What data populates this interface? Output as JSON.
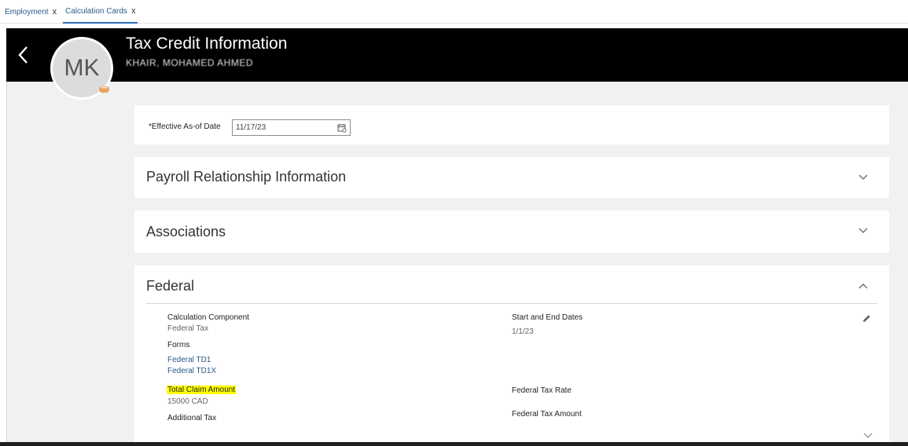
{
  "tabs": [
    {
      "label": "Employment",
      "close": "x"
    },
    {
      "label": "Calculation Cards",
      "close": "x"
    }
  ],
  "header": {
    "title": "Tax Credit Information",
    "subtitle": "KHAIR, MOHAMED AHMED",
    "avatar_initials": "MK",
    "avatar_badge": "•••"
  },
  "effective_date": {
    "label": "*Effective As-of Date",
    "value": "11/17/23"
  },
  "sections": {
    "payroll": "Payroll Relationship Information",
    "associations": "Associations",
    "federal": "Federal"
  },
  "federal": {
    "calc_component_label": "Calculation Component",
    "calc_component_value": "Federal Tax",
    "forms_label": "Forms",
    "forms": [
      "Federal TD1",
      "Federal TD1X"
    ],
    "total_claim_label": "Total Claim Amount",
    "total_claim_value": "15000 CAD",
    "additional_tax_label": "Additional Tax",
    "dates_label": "Start and End Dates",
    "dates_value": "1/1/23",
    "tax_rate_label": "Federal Tax Rate",
    "tax_amount_label": "Federal Tax Amount"
  },
  "colors": {
    "header_bg": "#000000",
    "link": "#2a5a8c",
    "highlight": "#ffff00"
  }
}
